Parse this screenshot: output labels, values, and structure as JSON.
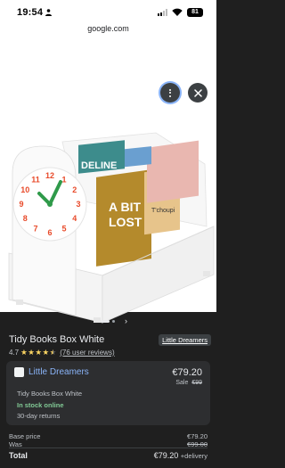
{
  "status_bar": {
    "time": "19:54",
    "battery": "81"
  },
  "browser": {
    "url": "google.com"
  },
  "image_viewer": {
    "source_label": "Little Dreamers",
    "product_art": {
      "sign_text": "DELINE",
      "book_title_line1": "A BIT",
      "book_title_line2": "LOST",
      "small_book_text": "T'choupi",
      "clock_numbers": [
        "12",
        "1",
        "2",
        "3",
        "4",
        "5",
        "6",
        "7",
        "8",
        "9",
        "10",
        "11"
      ]
    }
  },
  "product": {
    "title": "Tidy Books Box White",
    "rating_value": "4.7",
    "rating_stars": 4.7,
    "reviews_text": "(76 user reviews)"
  },
  "offer": {
    "seller": "Little Dreamers",
    "price": "€79.20",
    "sale_label": "Sale",
    "was_price": "€99",
    "product_name": "Tidy Books Box White",
    "stock": "In stock online",
    "returns": "30-day returns"
  },
  "summary": {
    "base_price_label": "Base price",
    "base_price": "€79.20",
    "was_label": "Was",
    "was_value": "€99.00",
    "total_label": "Total",
    "total_value": "€79.20",
    "delivery": "+delivery"
  },
  "colors": {
    "accent_link": "#8ab4f8",
    "in_stock": "#81c995",
    "star": "#fdd663",
    "background": "#1f1f1f"
  }
}
